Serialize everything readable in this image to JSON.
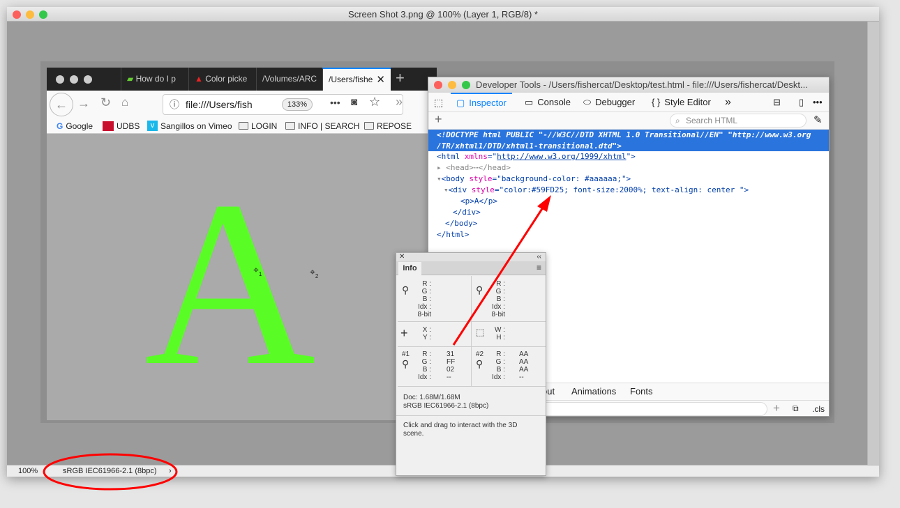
{
  "photoshop": {
    "title": "Screen Shot 3.png @ 100% (Layer 1, RGB/8) *",
    "status_zoom": "100%",
    "status_profile": "sRGB IEC61966-2.1 (8bpc)",
    "status_arrow": "›"
  },
  "browser": {
    "tabs": [
      {
        "label": "How do I p"
      },
      {
        "label": "Color picke"
      },
      {
        "label": "/Volumes/ARC"
      },
      {
        "label": "/Users/fishe",
        "active": true
      }
    ],
    "url": "file:///Users/fish",
    "zoom": "133%",
    "bookmarks": [
      {
        "label": "Google",
        "icon": "google-icon"
      },
      {
        "label": "UDBS",
        "icon": "udbs-icon"
      },
      {
        "label": "Sangillos on Vimeo",
        "icon": "vimeo-icon"
      },
      {
        "label": "LOGIN",
        "icon": "folder-icon"
      },
      {
        "label": "INFO | SEARCH",
        "icon": "folder-icon"
      },
      {
        "label": "REPOSE",
        "icon": "folder-icon"
      }
    ],
    "content_letter": "A",
    "content_color": "#59FD25",
    "background": "#aaaaaa"
  },
  "devtools": {
    "title": "Developer Tools - /Users/fishercat/Desktop/test.html - file:///Users/fishercat/Deskt...",
    "tools": [
      "Inspector",
      "Console",
      "Debugger",
      "Style Editor"
    ],
    "search_placeholder": "Search HTML",
    "markup": {
      "doctype1": "<!DOCTYPE html PUBLIC \"-//W3C//DTD XHTML 1.0 Transitional//EN\" \"http://www.w3.org",
      "doctype2": "/TR/xhtml1/DTD/xhtml1-transitional.dtd\">",
      "html_open": "<html ",
      "html_attr": "xmlns",
      "html_val": "http://www.w3.org/1999/xhtml",
      "head": "<head>⋯</head>",
      "body_attr": "style",
      "body_val": "background-color: #aaaaaa;",
      "div_attr": "style",
      "div_val": "color:#59FD25; font-size:2000%; text-align: center ",
      "p": "<p>A</p>",
      "div_close": "</div>",
      "body_close": "</body>",
      "html_close": "</html>"
    },
    "bottom_tabs": [
      "out",
      "Animations",
      "Fonts"
    ],
    "cls": ".cls"
  },
  "info": {
    "tab": "Info",
    "labels": {
      "r": "R :",
      "g": "G :",
      "b": "B :",
      "idx": "Idx :",
      "bit": "8-bit",
      "x": "X :",
      "y": "Y :",
      "w": "W :",
      "h": "H :"
    },
    "sample1": {
      "id": "#1",
      "r": "31",
      "g": "FF",
      "b": "02",
      "idx": "--"
    },
    "sample2": {
      "id": "#2",
      "r": "AA",
      "g": "AA",
      "b": "AA",
      "idx": "--"
    },
    "doc": "Doc: 1.68M/1.68M",
    "profile": "sRGB IEC61966-2.1 (8bpc)",
    "hint": "Click and drag to interact with the 3D scene."
  },
  "annotation_color": "#ff0000"
}
